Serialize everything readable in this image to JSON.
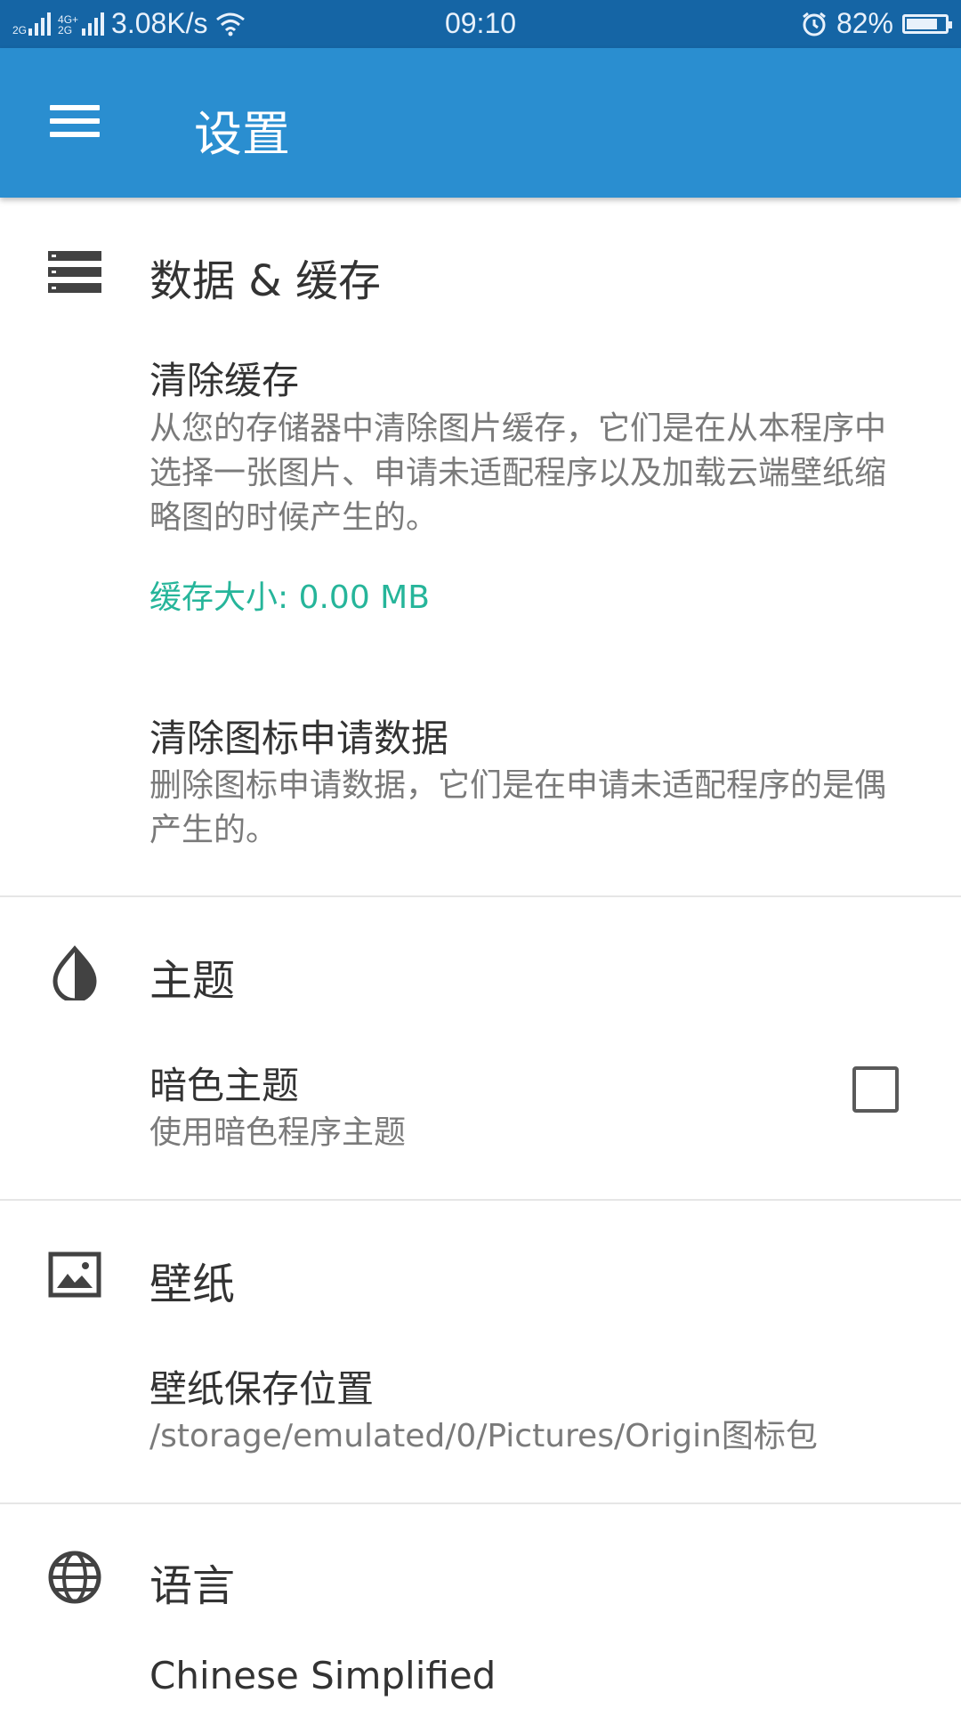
{
  "status_bar": {
    "net_1": "2G",
    "net_2_top": "4G+",
    "net_2_bottom": "2G",
    "speed": "3.08K/s",
    "time": "09:10",
    "battery": "82%",
    "battery_level": 0.82
  },
  "app_bar": {
    "title": "设置",
    "menu_icon": "hamburger-menu-icon"
  },
  "sections": {
    "data_cache": {
      "icon": "storage-icon",
      "title": "数据 & 缓存",
      "clear_cache": {
        "title": "清除缓存",
        "summary": "从您的存储器中清除图片缓存，它们是在从本程序中选择一张图片、申请未适配程序以及加载云端壁纸缩略图的时候产生的。",
        "cache_size": "缓存大小: 0.00 MB"
      },
      "clear_icon_requests": {
        "title": "清除图标申请数据",
        "summary": "删除图标申请数据，它们是在申请未适配程序的是偶产生的。"
      }
    },
    "theme": {
      "icon": "invert-colors-icon",
      "title": "主题",
      "dark_theme": {
        "title": "暗色主题",
        "summary": "使用暗色程序主题",
        "checked": false
      }
    },
    "wallpaper": {
      "icon": "wallpaper-icon",
      "title": "壁纸",
      "save_location": {
        "title": "壁纸保存位置",
        "summary": "/storage/emulated/0/Pictures/Origin图标包"
      }
    },
    "language": {
      "icon": "globe-icon",
      "title": "语言",
      "current": "Chinese Simplified"
    }
  },
  "colors": {
    "status_bar": "#1565a5",
    "app_bar": "#2a8ed0",
    "accent": "#26b59a"
  }
}
